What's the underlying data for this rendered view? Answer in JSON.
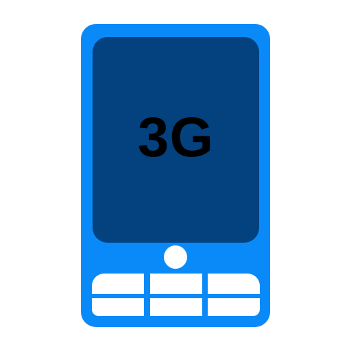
{
  "device": {
    "screen_label": "3G",
    "body_color": "#0a8af8",
    "screen_color": "#03417f",
    "key_color": "#ffffff"
  },
  "icons": {
    "device": "mobile-phone-icon",
    "home_button": "home-button-icon",
    "keypad": "keypad-icon"
  }
}
